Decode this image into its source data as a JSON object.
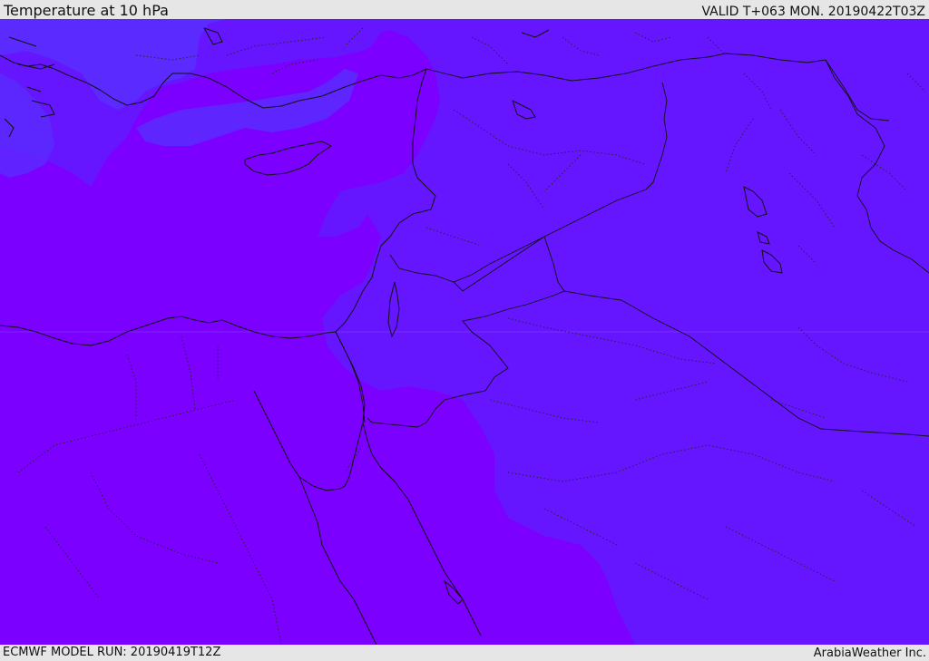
{
  "header": {
    "title": "Temperature at 10 hPa",
    "valid": "VALID T+063 MON. 20190422T03Z"
  },
  "footer": {
    "model_run": "ECMWF MODEL RUN: 20190419T12Z",
    "credit": "ArabiaWeather Inc."
  },
  "colors": {
    "band_violet": "#7b00ff",
    "band_indigo": "#6516ff",
    "band_blue": "#5a2cff",
    "line": "#111111",
    "bar": "#e6e6e6"
  }
}
